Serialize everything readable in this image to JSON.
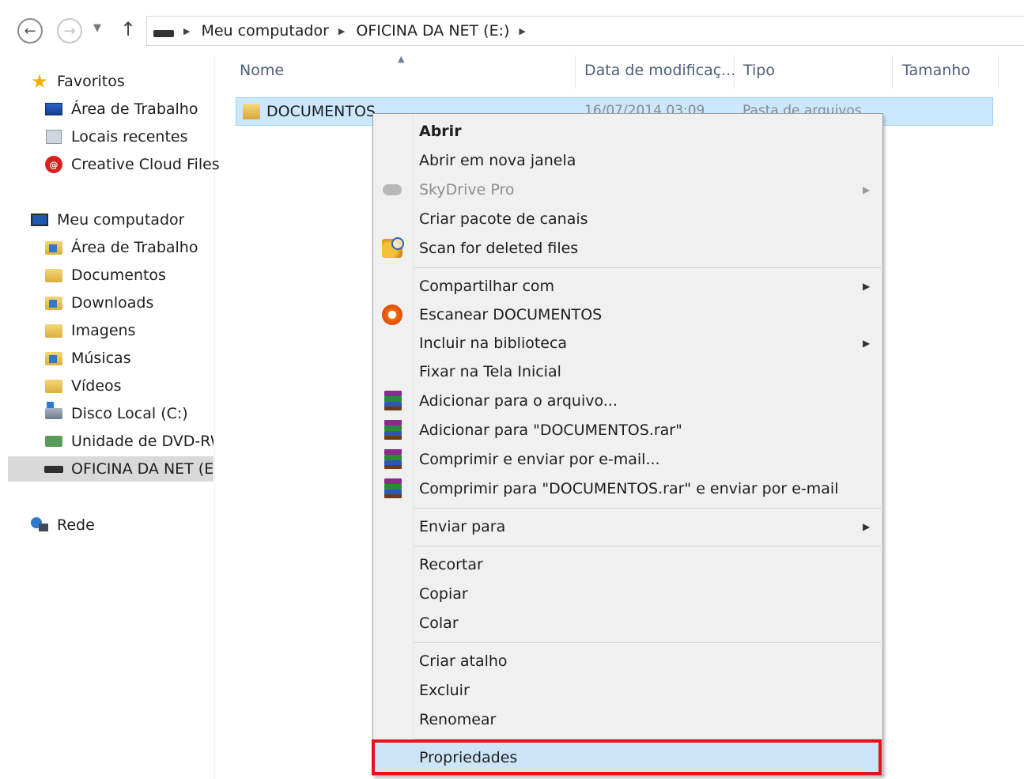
{
  "address_bar": {
    "crumbs": [
      "Meu computador",
      "OFICINA DA NET (E:)"
    ]
  },
  "nav_pane": {
    "favorites": {
      "label": "Favoritos",
      "items": [
        "Área de Trabalho",
        "Locais recentes",
        "Creative Cloud Files"
      ]
    },
    "computer": {
      "label": "Meu computador",
      "items": [
        "Área de Trabalho",
        "Documentos",
        "Downloads",
        "Imagens",
        "Músicas",
        "Vídeos",
        "Disco Local (C:)",
        "Unidade de DVD-RW",
        "OFICINA DA NET (E:)"
      ]
    },
    "network": {
      "label": "Rede"
    },
    "icons": [
      "star-icon",
      "desktop-icon",
      "recent-places-icon",
      "creative-cloud-icon",
      "computer-icon",
      "desktop-folder-icon",
      "documents-folder-icon",
      "downloads-folder-icon",
      "pictures-folder-icon",
      "music-folder-icon",
      "videos-folder-icon",
      "local-disk-icon",
      "dvd-drive-icon",
      "usb-drive-icon",
      "network-icon"
    ]
  },
  "file_list": {
    "columns": [
      "Nome",
      "Data de modificaç...",
      "Tipo",
      "Tamanho"
    ],
    "rows": [
      {
        "name": "DOCUMENTOS",
        "date": "16/07/2014 03:09",
        "type": "Pasta de arquivos"
      }
    ]
  },
  "context_menu": {
    "items": {
      "open": "Abrir",
      "open_new_window": "Abrir em nova janela",
      "skydrive_pro": "SkyDrive Pro",
      "create_channel_package": "Criar pacote de canais",
      "scan_deleted": "Scan for deleted files",
      "share_with": "Compartilhar com",
      "scan_documents": "Escanear DOCUMENTOS",
      "include_library": "Incluir na biblioteca",
      "pin_start": "Fixar na Tela Inicial",
      "add_to_archive": "Adicionar para o arquivo...",
      "add_to_rar": "Adicionar para \"DOCUMENTOS.rar\"",
      "compress_email": "Comprimir e enviar por e-mail...",
      "compress_rar_email": "Comprimir para \"DOCUMENTOS.rar\" e enviar por e-mail",
      "send_to": "Enviar para",
      "cut": "Recortar",
      "copy": "Copiar",
      "paste": "Colar",
      "create_shortcut": "Criar atalho",
      "delete": "Excluir",
      "rename": "Renomear",
      "properties": "Propriedades"
    },
    "highlight_color": "#e0121a",
    "hover_color": "#cde6f7"
  },
  "colors": {
    "selection_bg": "#cce8ff",
    "selection_border": "#99d1ff",
    "column_header_text": "#4c607a"
  }
}
